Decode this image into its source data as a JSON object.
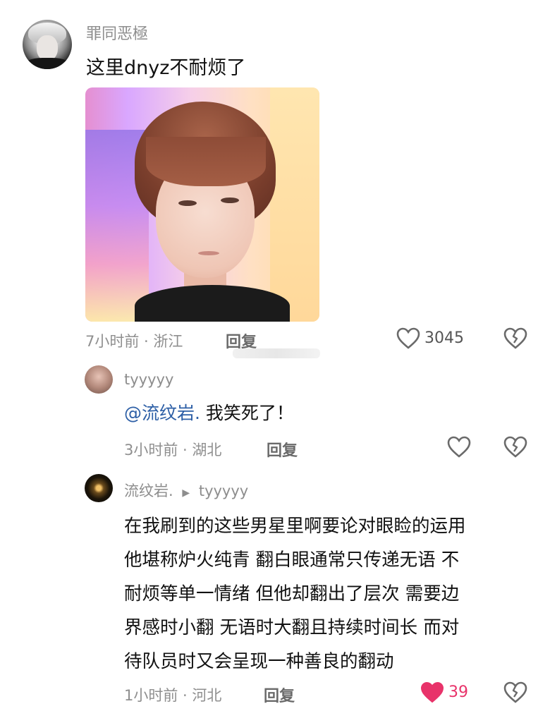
{
  "comment": {
    "username": "罪同恶極",
    "text": "这里dnyz不耐烦了",
    "meta": "7小时前 · 浙江",
    "reply_label": "回复",
    "likes": "3045",
    "liked": false
  },
  "replies": [
    {
      "username": "tyyyyy",
      "mention": "@流纹岩.",
      "text": " 我笑死了！",
      "meta": "3小时前 · 湖北",
      "reply_label": "回复",
      "likes": "",
      "liked": false
    },
    {
      "username": "流纹岩.",
      "reply_to_arrow": "▶",
      "reply_to": "tyyyyy",
      "lines": [
        "在我刷到的这些男星里啊要论对眼睑的运用",
        "他堪称炉火纯青 翻白眼通常只传递无语 不",
        "耐烦等单一情绪 但他却翻出了层次 需要边",
        "界感时小翻 无语时大翻且持续时间长 而对",
        "待队员时又会呈现一种善良的翻动"
      ],
      "meta": "1小时前 · 河北",
      "reply_label": "回复",
      "likes": "39",
      "liked": true
    }
  ],
  "icons": {
    "heart": "heart-icon",
    "dislike": "broken-heart-icon"
  },
  "colors": {
    "liked": "#e8336a",
    "mention": "#2d5fa6",
    "meta": "#8f8f8f"
  }
}
